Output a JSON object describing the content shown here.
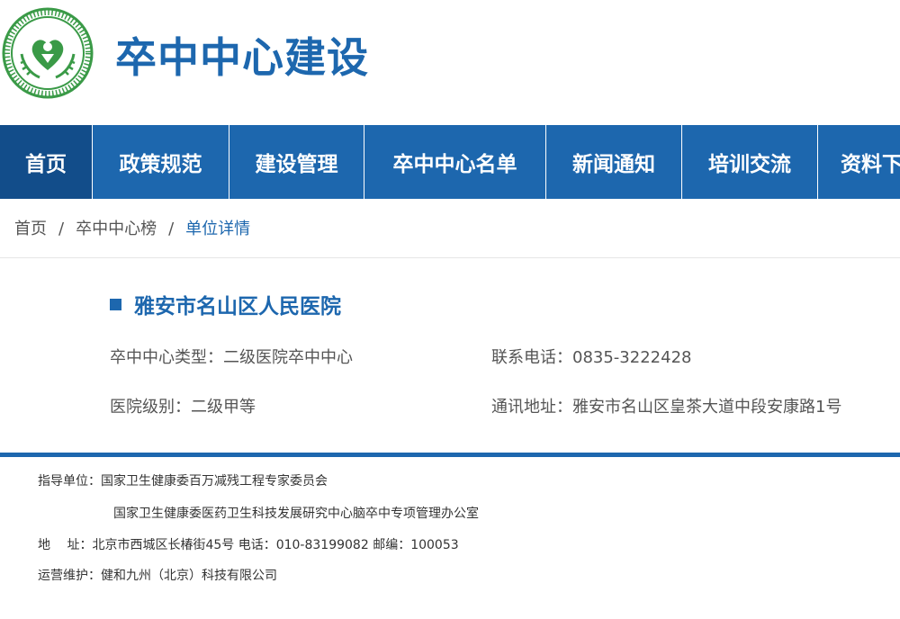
{
  "header": {
    "title": "卒中中心建设",
    "logo_icon": "committee-emblem-logo",
    "brand_color": "#1d67ae"
  },
  "nav": {
    "items": [
      {
        "label": "首页",
        "active": true
      },
      {
        "label": "政策规范"
      },
      {
        "label": "建设管理"
      },
      {
        "label": "卒中中心名单"
      },
      {
        "label": "新闻通知"
      },
      {
        "label": "培训交流"
      },
      {
        "label": "资料下"
      }
    ]
  },
  "breadcrumb": {
    "home": "首页",
    "separator": "/",
    "list": "卒中中心榜",
    "current": "单位详情"
  },
  "hospital": {
    "name": "雅安市名山区人民医院",
    "type": "卒中中心类型：二级医院卒中中心",
    "phone": "联系电话：0835-3222428",
    "level": "医院级别：二级甲等",
    "address": "通讯地址：雅安市名山区皇茶大道中段安康路1号"
  },
  "footer": {
    "guide_label": "指导单位：",
    "guide_1": "国家卫生健康委百万减残工程专家委员会",
    "guide_2": "国家卫生健康委医药卫生科技发展研究中心脑卒中专项管理办公室",
    "address_line": "地　 址：北京市西城区长椿街45号  电话：010-83199082  邮编：100053",
    "operator_line": "运营维护：健和九州（北京）科技有限公司"
  }
}
